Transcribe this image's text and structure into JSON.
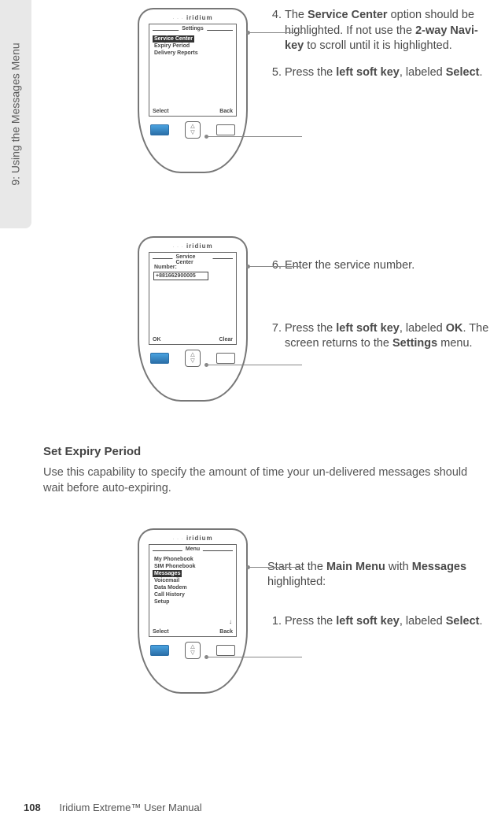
{
  "side_tab": "9: Using the Messages Menu",
  "brand": "iridium",
  "screen1": {
    "title": "Settings",
    "items": [
      "Service Center",
      "Expiry Period",
      "Delivery Reports"
    ],
    "highlighted": 0,
    "left_key": "Select",
    "right_key": "Back"
  },
  "screen2": {
    "title": "Service Center",
    "label": "Number:",
    "value": "+881662900005",
    "left_key": "OK",
    "right_key": "Clear"
  },
  "screen3": {
    "title": "Menu",
    "items": [
      "My Phonebook",
      "SIM Phonebook",
      "Messages",
      "Voicemail",
      "Data Modem",
      "Call History",
      "Setup"
    ],
    "highlighted": 2,
    "left_key": "Select",
    "right_key": "Back"
  },
  "steps": {
    "s4": "The <b>Service Center</b> option should be highlighted. If not use the <b>2-way Navi-key</b> to scroll until it is highlighted.",
    "s5": "Press the <b>left soft key</b>, labeled <b>Select</b>.",
    "s6": "Enter the service number.",
    "s7": "Press the <b>left soft key</b>, labeled <b>OK</b>. The screen returns to the <b>Settings</b> menu.",
    "intro3": "Start at the <b>Main Menu</b> with <b>Messages</b> highlighted:",
    "s1": "Press the <b>left soft key</b>, labeled <b>Select</b>."
  },
  "heading": "Set Expiry Period",
  "para": "Use this capability to specify the amount of time your un-delivered messages should wait before auto-expiring.",
  "footer_page": "108",
  "footer_text": "Iridium Extreme™ User Manual"
}
